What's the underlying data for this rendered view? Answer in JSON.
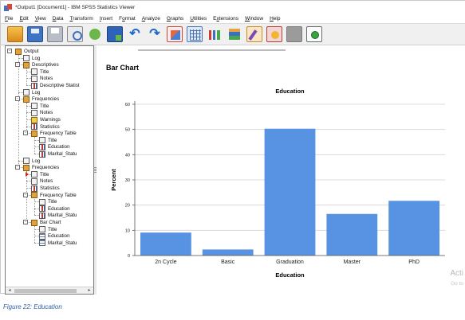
{
  "window": {
    "title": "*Output1 [Document1] - IBM SPSS Statistics Viewer"
  },
  "menu": [
    {
      "label": "File",
      "accel": "F"
    },
    {
      "label": "Edit",
      "accel": "E"
    },
    {
      "label": "View",
      "accel": "V"
    },
    {
      "label": "Data",
      "accel": "D"
    },
    {
      "label": "Transform",
      "accel": "T"
    },
    {
      "label": "Insert",
      "accel": "I"
    },
    {
      "label": "Format",
      "accel": "o"
    },
    {
      "label": "Analyze",
      "accel": "A"
    },
    {
      "label": "Graphs",
      "accel": "G"
    },
    {
      "label": "Utilities",
      "accel": "U"
    },
    {
      "label": "Extensions",
      "accel": "x"
    },
    {
      "label": "Window",
      "accel": "W"
    },
    {
      "label": "Help",
      "accel": "H"
    }
  ],
  "toolbar": [
    "open-folder-icon",
    "save-icon",
    "print-icon",
    "print-preview-icon",
    "export-icon",
    "goto-data-icon",
    "undo-icon",
    "redo-icon",
    "chart-builder-icon",
    "goto-case-icon",
    "bar-chart-icon",
    "stacked-chart-icon",
    "edit-icon",
    "script-icon",
    "disabled-icon",
    "add-icon"
  ],
  "tree": {
    "nodes": [
      {
        "label": "Output",
        "icon": "book-icon",
        "toggle": "-"
      },
      {
        "label": "Log",
        "icon": "doc-icon"
      },
      {
        "label": "Descriptives",
        "icon": "book-icon",
        "toggle": "-"
      },
      {
        "label": "Title",
        "icon": "doc-icon"
      },
      {
        "label": "Notes",
        "icon": "doc-icon"
      },
      {
        "label": "Descriptive Statist",
        "icon": "chart-icon"
      },
      {
        "label": "Log",
        "icon": "doc-icon"
      },
      {
        "label": "Frequencies",
        "icon": "book-icon",
        "toggle": "-"
      },
      {
        "label": "Title",
        "icon": "doc-icon"
      },
      {
        "label": "Notes",
        "icon": "doc-icon"
      },
      {
        "label": "Warnings",
        "icon": "warn-icon"
      },
      {
        "label": "Statistics",
        "icon": "chart-icon"
      },
      {
        "label": "Frequency Table",
        "icon": "book-icon",
        "toggle": "-"
      },
      {
        "label": "Title",
        "icon": "doc-icon"
      },
      {
        "label": "Education",
        "icon": "chart-icon"
      },
      {
        "label": "Marital_Statu",
        "icon": "chart-icon"
      },
      {
        "label": "Log",
        "icon": "doc-icon"
      },
      {
        "label": "Frequencies",
        "icon": "book-icon",
        "toggle": "-"
      },
      {
        "label": "Title",
        "icon": "doc-icon",
        "selected": true
      },
      {
        "label": "Notes",
        "icon": "doc-icon"
      },
      {
        "label": "Statistics",
        "icon": "chart-icon"
      },
      {
        "label": "Frequency Table",
        "icon": "book-icon",
        "toggle": "-"
      },
      {
        "label": "Title",
        "icon": "doc-icon"
      },
      {
        "label": "Education",
        "icon": "chart-icon"
      },
      {
        "label": "Marital_Statu",
        "icon": "chart-icon"
      },
      {
        "label": "Bar Chart",
        "icon": "book-icon",
        "toggle": "-"
      },
      {
        "label": "Title",
        "icon": "doc-icon"
      },
      {
        "label": "Education",
        "icon": "table-icon"
      },
      {
        "label": "Marital_Statu",
        "icon": "table-icon"
      }
    ],
    "depths": [
      0,
      1,
      1,
      2,
      2,
      2,
      1,
      1,
      2,
      2,
      2,
      2,
      2,
      3,
      3,
      3,
      1,
      1,
      2,
      2,
      2,
      2,
      3,
      3,
      3,
      2,
      3,
      3,
      3
    ]
  },
  "content": {
    "section_title": "Bar Chart"
  },
  "chart_data": {
    "type": "bar",
    "title": "Education",
    "xlabel": "Education",
    "ylabel": "Percent",
    "categories": [
      "2n Cycle",
      "Basic",
      "Graduation",
      "Master",
      "PhD"
    ],
    "values": [
      9.1,
      2.4,
      50.3,
      16.5,
      21.7
    ],
    "ylim": [
      0,
      60
    ],
    "yticks": [
      0,
      10,
      20,
      30,
      40,
      50,
      60
    ],
    "grid": true,
    "bar_color": "#5893e3"
  },
  "watermark": {
    "line1": "Acti",
    "line2": "Go to"
  },
  "caption": "Figure 22: Education"
}
